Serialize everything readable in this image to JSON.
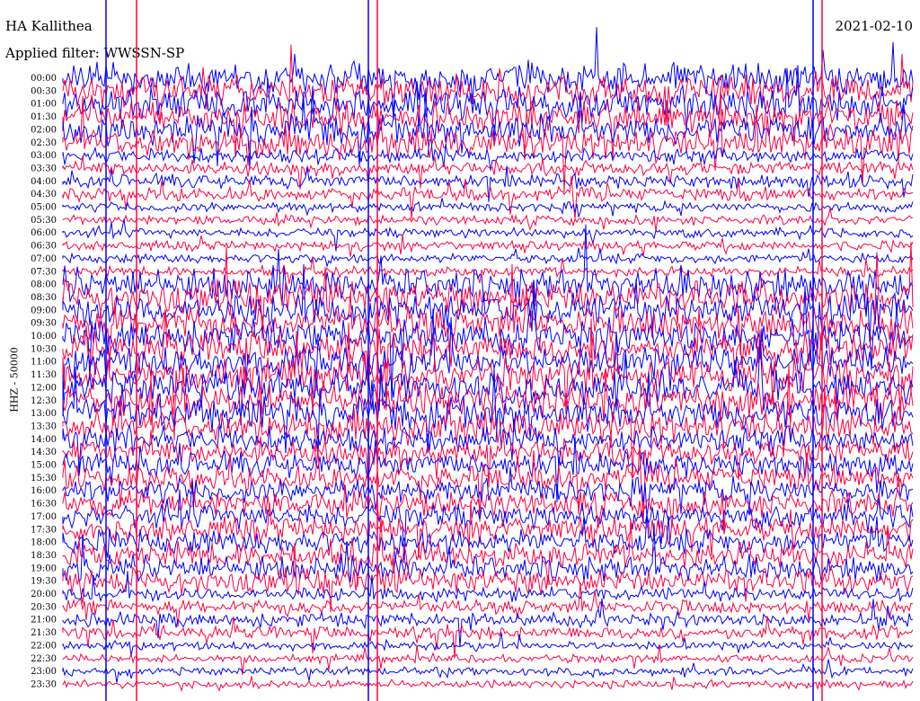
{
  "header": {
    "station": "HA Kallithea",
    "filter": "Applied filter: WWSSN-SP",
    "date": "2021-02-10",
    "channel": "HHZ - 50000"
  },
  "chart_data": {
    "type": "line",
    "title": "HA Kallithea",
    "ylabel": "HHZ - 50000",
    "row_labels": [
      "00:00",
      "00:30",
      "01:00",
      "01:30",
      "02:00",
      "02:30",
      "03:00",
      "03:30",
      "04:00",
      "04:30",
      "05:00",
      "05:30",
      "06:00",
      "06:30",
      "07:00",
      "07:30",
      "08:00",
      "08:30",
      "09:00",
      "09:30",
      "10:00",
      "10:30",
      "11:00",
      "11:30",
      "12:00",
      "12:30",
      "13:00",
      "13:30",
      "14:00",
      "14:30",
      "15:00",
      "15:30",
      "16:00",
      "16:30",
      "17:00",
      "17:30",
      "18:00",
      "18:30",
      "19:00",
      "19:30",
      "20:00",
      "20:30",
      "21:00",
      "21:30",
      "22:00",
      "22:30",
      "23:00",
      "23:30"
    ],
    "trace_colors": [
      "#0000ff",
      "#ff0040"
    ],
    "grid": false
  }
}
